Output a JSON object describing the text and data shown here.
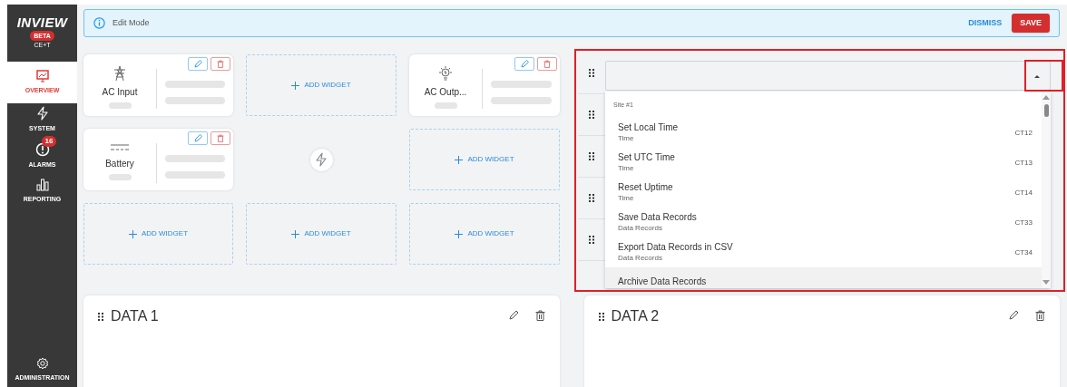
{
  "brand": {
    "name": "INVIEW",
    "badge": "BETA",
    "subtitle": "CE+T"
  },
  "sidebar": {
    "items": [
      {
        "label": "OVERVIEW",
        "selected": true
      },
      {
        "label": "SYSTEM",
        "selected": false
      },
      {
        "label": "ALARMS",
        "selected": false,
        "badge": "16"
      },
      {
        "label": "REPORTING",
        "selected": false
      }
    ],
    "footer_item": {
      "label": "ADMINISTRATION",
      "selected": false
    }
  },
  "banner": {
    "message": "Edit Mode",
    "dismiss": "DISMISS",
    "save": "SAVE"
  },
  "widgets": [
    {
      "kind": "device",
      "label": "AC Input"
    },
    {
      "kind": "empty",
      "label": "ADD WIDGET"
    },
    {
      "kind": "device",
      "label": "AC Outp..."
    },
    {
      "kind": "device",
      "label": "Battery"
    },
    {
      "kind": "hub"
    },
    {
      "kind": "empty",
      "label": "ADD WIDGET"
    },
    {
      "kind": "empty",
      "label": "ADD WIDGET"
    },
    {
      "kind": "empty",
      "label": "ADD WIDGET"
    },
    {
      "kind": "empty",
      "label": "ADD WIDGET"
    }
  ],
  "selector": {
    "expanded": true,
    "group": "Site #1",
    "options": [
      {
        "label": "Set Local Time",
        "category": "Time",
        "code": "CT12",
        "selected": false
      },
      {
        "label": "Set UTC Time",
        "category": "Time",
        "code": "CT13",
        "selected": false
      },
      {
        "label": "Reset Uptime",
        "category": "Time",
        "code": "CT14",
        "selected": false
      },
      {
        "label": "Save Data Records",
        "category": "Data Records",
        "code": "CT33",
        "selected": false
      },
      {
        "label": "Export Data Records in CSV",
        "category": "Data Records",
        "code": "CT34",
        "selected": false
      },
      {
        "label": "Archive Data Records",
        "selected": true
      }
    ]
  },
  "data_cards": [
    {
      "title": "DATA 1"
    },
    {
      "title": "DATA 2"
    }
  ]
}
